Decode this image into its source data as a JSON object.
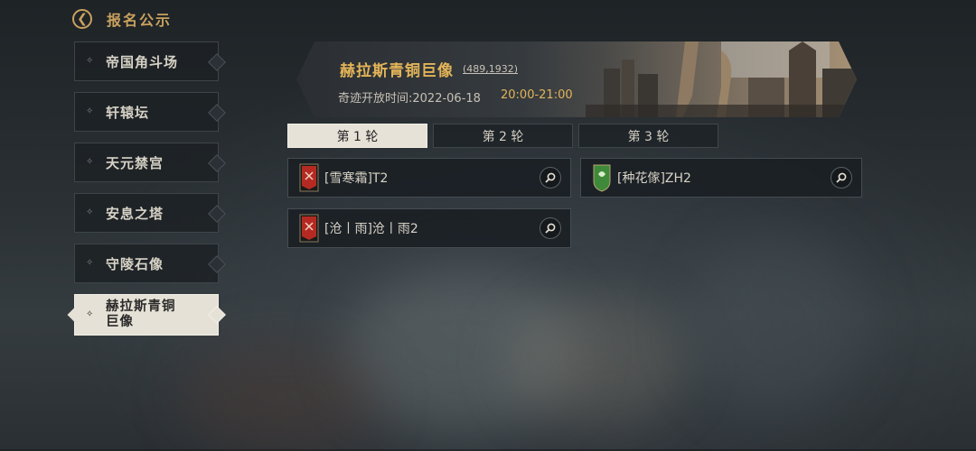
{
  "header": {
    "title": "报名公示",
    "back_icon": "back-arrow-icon"
  },
  "sidebar": {
    "items": [
      {
        "label": "帝国角斗场",
        "active": false
      },
      {
        "label": "轩辕坛",
        "active": false
      },
      {
        "label": "天元禁宫",
        "active": false
      },
      {
        "label": "安息之塔",
        "active": false
      },
      {
        "label": "守陵石像",
        "active": false
      },
      {
        "label": "赫拉斯青铜巨像",
        "active": true
      }
    ]
  },
  "banner": {
    "title": "赫拉斯青铜巨像",
    "coords": "(489,1932)",
    "time_label": "奇迹开放时间:2022-06-18",
    "time_range": "20:00-21:00"
  },
  "tabs": [
    {
      "label": "第 1 轮",
      "active": true
    },
    {
      "label": "第 2 轮",
      "active": false
    },
    {
      "label": "第 3 轮",
      "active": false
    }
  ],
  "entries": [
    {
      "name": "[雪寒霜]T2",
      "flag_color": "#b42a22",
      "icon": "red-guild-flag-icon"
    },
    {
      "name": "[种花傢]ZH2",
      "flag_color": "#3f8a3a",
      "icon": "green-guild-shield-icon"
    },
    {
      "name": "[沧丨雨]沧丨雨2",
      "flag_color": "#b42a22",
      "icon": "red-guild-flag-icon"
    }
  ],
  "colors": {
    "accent_gold": "#e3b458",
    "active_bg": "#e6e1d6"
  }
}
